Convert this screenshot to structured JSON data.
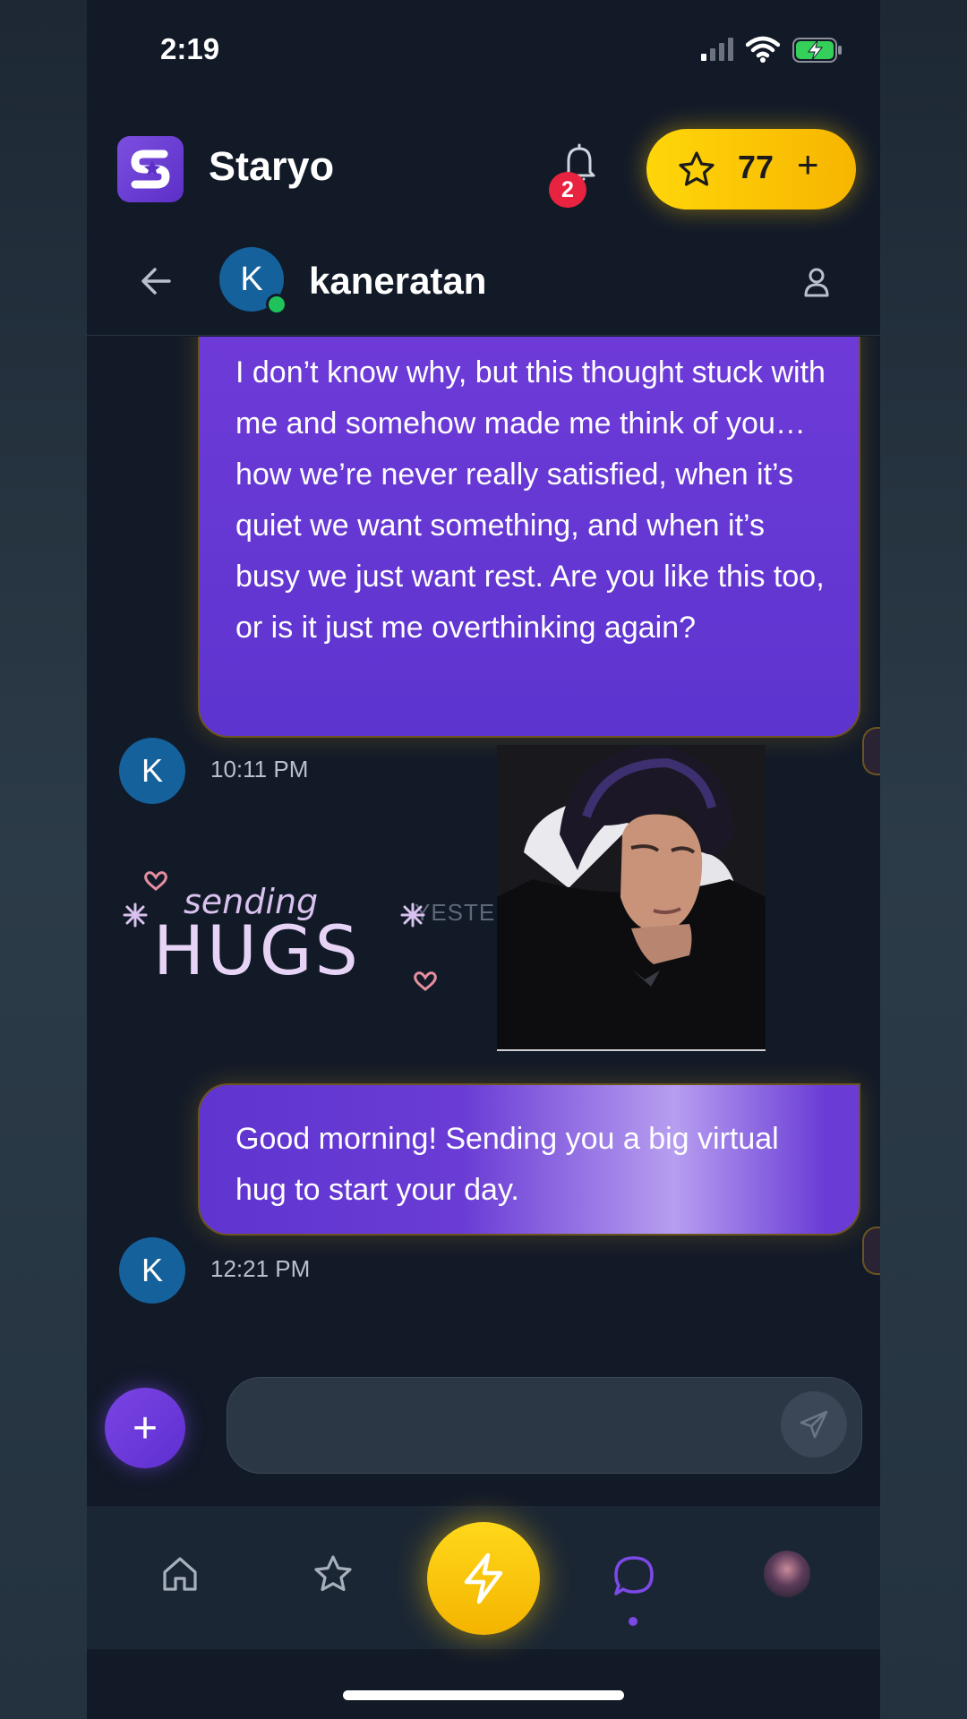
{
  "status_bar": {
    "time": "2:19"
  },
  "app": {
    "name": "Staryo",
    "notification_count": "2",
    "points": "77",
    "points_plus": "+"
  },
  "chat": {
    "contact_name": "kaneratan",
    "contact_initial": "K"
  },
  "messages": [
    {
      "text": "I don’t know why, but this thought stuck with me and somehow made me think of you… how we’re never really satisfied, when it’s quiet we want something, and when it’s busy we just want rest. Are you like this too, or is it just me overthinking again?",
      "time": "10:11 PM",
      "avatar": "K"
    },
    {
      "text": "Good morning! Sending you a big virtual hug to start your day.",
      "time": "12:21 PM",
      "avatar": "K"
    }
  ],
  "day_divider": "YESTE",
  "sticker": {
    "line1": "sending",
    "line2": "HUGS"
  },
  "composer": {
    "add_label": "+",
    "placeholder": ""
  },
  "icons": {
    "logo": "staryo-logo-icon",
    "bell": "bell-icon",
    "star": "star-icon",
    "back": "arrow-left-icon",
    "profile": "user-icon",
    "send": "send-icon",
    "home": "home-icon",
    "favorites": "star-icon",
    "boost": "lightning-icon",
    "chat": "chat-bubble-icon"
  },
  "colors": {
    "accent_purple": "#6a3cd5",
    "accent_yellow": "#ffd60a",
    "background": "#121a28",
    "badge_red": "#e8233f",
    "online_green": "#1fc25b"
  }
}
